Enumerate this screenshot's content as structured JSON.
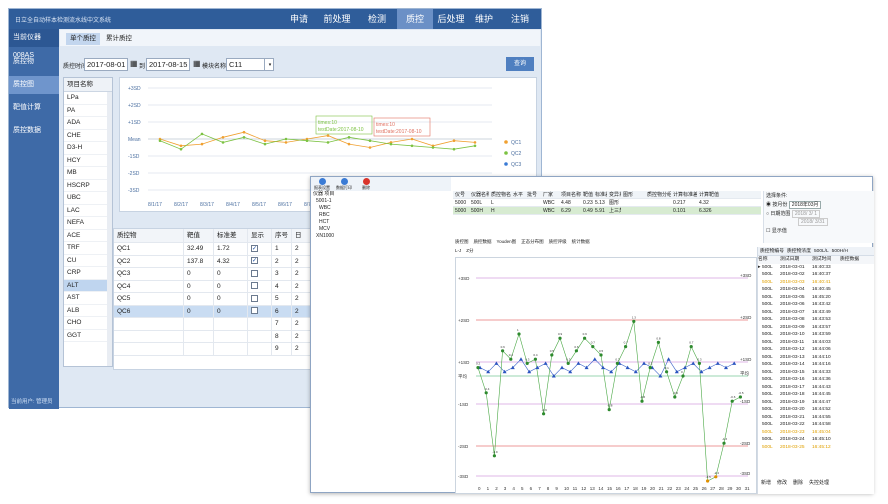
{
  "app": {
    "title": "日立全自动样本检测流水线中文系统",
    "brand": "当前仪器008AS"
  },
  "menu": [
    "申请",
    "前处理",
    "检测",
    "质控",
    "后处理",
    "维护",
    "注销"
  ],
  "menu_active": "质控",
  "sidebar": {
    "items": [
      "质控物",
      "质控图",
      "靶值计算",
      "质控数据"
    ],
    "active": "质控图",
    "user": "当前用户: 管理员"
  },
  "subtabs": [
    "单个质控",
    "累计质控"
  ],
  "filter": {
    "time_label": "质控时间",
    "from": "2017-08-01",
    "to_label": "到",
    "to": "2017-08-15",
    "module_label": "模块名称",
    "module": "C11",
    "query": "查询"
  },
  "items": {
    "header": "项目名称",
    "rows": [
      "LPa",
      "PA",
      "ADA",
      "CHE",
      "D3-H",
      "HCY",
      "MB",
      "HSCRP",
      "UBC",
      "LAC",
      "NEFA",
      "ACE",
      "TRF",
      "CU",
      "CRP",
      "ALT",
      "AST",
      "ALB",
      "CHO",
      "GGT"
    ],
    "selected": "ALT"
  },
  "chart1": {
    "y_ticks": [
      "+3SD",
      "+2SD",
      "+1SD",
      "Mean",
      "-1SD",
      "-2SD",
      "-3SD"
    ],
    "x_ticks": [
      "8/1/17",
      "8/2/17",
      "8/3/17",
      "8/4/17",
      "8/5/17",
      "8/6/17",
      "8/7/17"
    ],
    "tip1": "times:10",
    "tip1b": "testDate:2017-08-10",
    "tip2": "times:10",
    "tip2b": "testDate:2017-08-10",
    "legend": [
      "QC1",
      "QC2",
      "QC3"
    ],
    "colors": {
      "qc1": "#f0a030",
      "qc2": "#7cc242",
      "qc3": "#3a7bd5"
    }
  },
  "qc_table": {
    "headers": [
      "质控物",
      "靶值",
      "标准差",
      "显示",
      "序号",
      "日"
    ],
    "rows": [
      [
        "QC1",
        "32.49",
        "1.72",
        "✓",
        "1",
        "2"
      ],
      [
        "QC2",
        "137.8",
        "4.32",
        "✓",
        "2",
        "2"
      ],
      [
        "QC3",
        "0",
        "0",
        "",
        "3",
        "2"
      ],
      [
        "QC4",
        "0",
        "0",
        "",
        "4",
        "2"
      ],
      [
        "QC5",
        "0",
        "0",
        "",
        "5",
        "2"
      ],
      [
        "QC6",
        "0",
        "0",
        "",
        "6",
        "2"
      ],
      [
        "",
        "",
        "",
        "",
        "7",
        "2"
      ],
      [
        "",
        "",
        "",
        "",
        "8",
        "2"
      ],
      [
        "",
        "",
        "",
        "",
        "9",
        "2"
      ]
    ],
    "selected_index": 5
  },
  "win2": {
    "toolbar": [
      "报表设置",
      "数据打印",
      "删除"
    ],
    "tree": [
      "仪器 项目",
      "5001-1",
      "WBC",
      "RBC",
      "HCT",
      "MCV",
      "XN1000"
    ],
    "grid_head": [
      "仪号",
      "仪器名称",
      "质控物名称",
      "水平",
      "批号",
      "厂家",
      "项目名称",
      "靶值",
      "标准差",
      "变异系数",
      "图形",
      "质控物分组",
      "计算标准差",
      "计算靶值"
    ],
    "grid_rows": [
      [
        "5000",
        "500L",
        "L",
        "",
        "",
        "WBC",
        "4.48",
        "0.23",
        "5.13",
        "图形",
        "",
        "",
        "0.217",
        "4.32"
      ],
      [
        "5000",
        "500H",
        "H",
        "",
        "",
        "WBC",
        "6.29",
        "0.49",
        "5.91",
        "上三角形",
        "",
        "",
        "0.101",
        "6.326"
      ]
    ],
    "cond": {
      "label": "选择条件:",
      "opt1": "按月份",
      "month": "2018年03月",
      "opt2": "日期范围",
      "d1": "2018/ 3/ 1",
      "d2": "2018/ 3/31",
      "cb": "显示值"
    },
    "tabs": [
      "质控图",
      "质控数据",
      "Youden图",
      "正态分布图",
      "质控评级",
      "统计数据"
    ],
    "subtabs": [
      "L-J",
      "Z分"
    ],
    "plot": {
      "labels_left": [
        "+3SD",
        "+2SD",
        "+1SD",
        "平均",
        "-1SD",
        "-2SD",
        "-3SD"
      ],
      "x_ticks": [
        "0",
        "1",
        "2",
        "3",
        "4",
        "5",
        "6",
        "7",
        "8",
        "9",
        "10",
        "11",
        "12",
        "13",
        "14",
        "15",
        "16",
        "17",
        "18",
        "19",
        "20",
        "21",
        "22",
        "23",
        "24",
        "25",
        "26",
        "27",
        "28",
        "29",
        "30",
        "31"
      ]
    },
    "right": {
      "header": [
        "质控物编号",
        "质控物浓度",
        "500L/L",
        "500H/H"
      ],
      "cols": [
        "名称",
        "测试日期",
        "测试时间",
        "质控数据"
      ],
      "rows": [
        [
          "500L",
          "2018-03-01",
          "16:40:33"
        ],
        [
          "500L",
          "2018-03-02",
          "16:40:37"
        ],
        [
          "500L",
          "2018-03-03",
          "16:40:41"
        ],
        [
          "500L",
          "2018-03-04",
          "16:40:45"
        ],
        [
          "500L",
          "2018-03-05",
          "16:45:20"
        ],
        [
          "500L",
          "2018-03-06",
          "16:43:42"
        ],
        [
          "500L",
          "2018-03-07",
          "16:43:49"
        ],
        [
          "500L",
          "2018-03-08",
          "16:43:53"
        ],
        [
          "500L",
          "2018-03-09",
          "16:43:57"
        ],
        [
          "500L",
          "2018-03-10",
          "16:43:59"
        ],
        [
          "500L",
          "2018-03-11",
          "16:44:03"
        ],
        [
          "500L",
          "2018-03-12",
          "16:44:06"
        ],
        [
          "500L",
          "2018-03-13",
          "16:44:10"
        ],
        [
          "500L",
          "2018-03-14",
          "16:44:16"
        ],
        [
          "500L",
          "2018-03-15",
          "16:44:33"
        ],
        [
          "500L",
          "2018-03-16",
          "16:44:36"
        ],
        [
          "500L",
          "2018-03-17",
          "16:44:43"
        ],
        [
          "500L",
          "2018-03-18",
          "16:44:45"
        ],
        [
          "500L",
          "2018-03-19",
          "16:44:47"
        ],
        [
          "500L",
          "2018-03-20",
          "16:44:52"
        ],
        [
          "500L",
          "2018-03-21",
          "16:44:55"
        ],
        [
          "500L",
          "2018-03-22",
          "16:44:58"
        ],
        [
          "500L",
          "2018-03-23",
          "16:45:04"
        ],
        [
          "500L",
          "2018-03-24",
          "16:45:10"
        ],
        [
          "500L",
          "2018-03-25",
          "16:45:12"
        ]
      ],
      "highlight": [
        2,
        22,
        24
      ],
      "buttons": [
        "新增",
        "修改",
        "删除",
        "失控处理"
      ]
    }
  }
}
